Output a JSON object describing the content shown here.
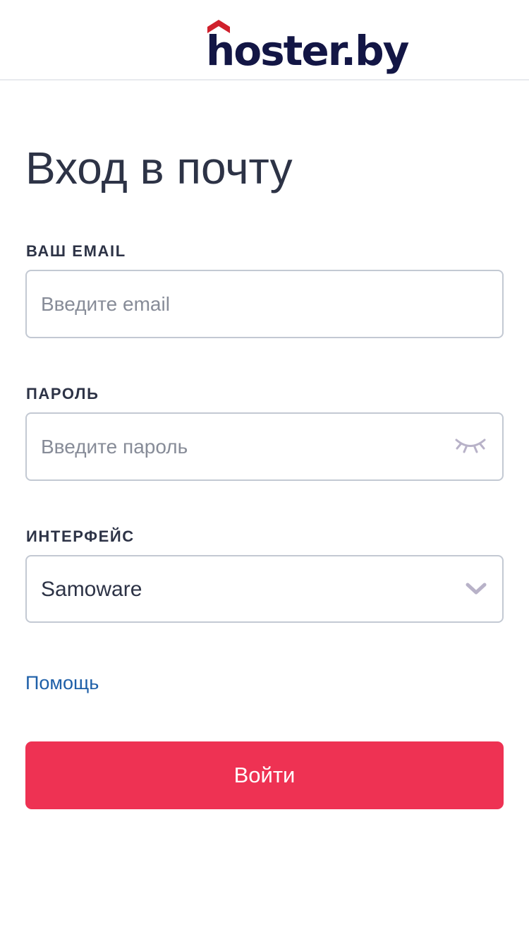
{
  "header": {
    "logo_text": "hoster.by",
    "logo_color": "#131645",
    "logo_accent_color": "#d0202c"
  },
  "page_title": "Вход в почту",
  "email": {
    "label": "ВАШ EMAIL",
    "placeholder": "Введите email",
    "value": ""
  },
  "password": {
    "label": "ПАРОЛЬ",
    "placeholder": "Введите пароль",
    "value": "",
    "toggle_icon": "eye-closed-icon"
  },
  "interface": {
    "label": "ИНТЕРФЕЙС",
    "selected": "Samoware",
    "dropdown_icon": "chevron-down-icon"
  },
  "help_link": "Помощь",
  "submit_label": "Войти",
  "colors": {
    "accent": "#ee3253",
    "link": "#1e5fa8",
    "text": "#2d3346",
    "border": "#c3c9d3"
  }
}
